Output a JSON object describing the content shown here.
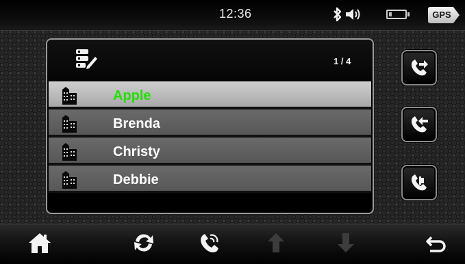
{
  "status_bar": {
    "time": "12:36",
    "gps_label": "GPS",
    "icons": [
      "bluetooth-icon",
      "volume-icon",
      "battery-icon"
    ]
  },
  "contacts_panel": {
    "page_indicator": "1 / 4",
    "header_icon": "contact-list-edit-icon",
    "contacts": [
      {
        "name": "Apple",
        "selected": true
      },
      {
        "name": "Brenda",
        "selected": false
      },
      {
        "name": "Christy",
        "selected": false
      },
      {
        "name": "Debbie",
        "selected": false
      }
    ]
  },
  "side_buttons": [
    "outgoing-call-icon",
    "missed-call-icon",
    "incoming-call-icon"
  ],
  "bottom_bar": [
    "home-icon",
    "sync-icon",
    "dial-icon",
    "up-arrow-icon",
    "down-arrow-icon",
    "back-icon"
  ],
  "colors": {
    "selected_text": "#22e000",
    "row_bg": "#606060",
    "selected_row_bg": "#bfbfbf"
  }
}
